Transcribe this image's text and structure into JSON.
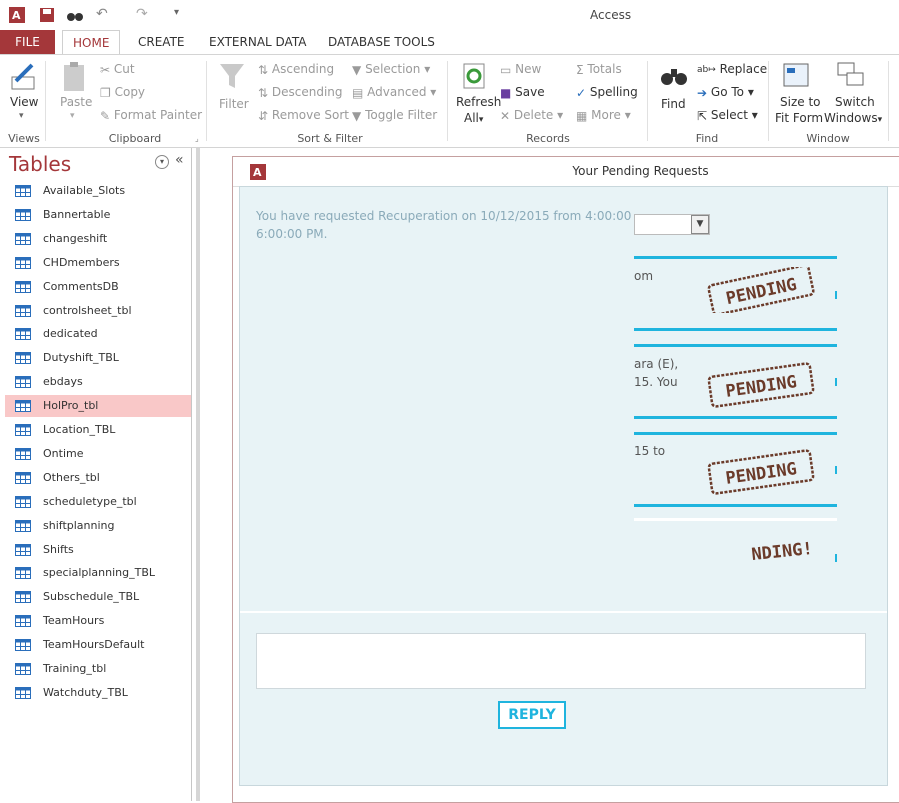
{
  "app": {
    "title": "Access"
  },
  "tabs": [
    "FILE",
    "HOME",
    "CREATE",
    "EXTERNAL DATA",
    "DATABASE TOOLS"
  ],
  "ribbon": {
    "views": {
      "label": "Views",
      "view": "View"
    },
    "clipboard": {
      "label": "Clipboard",
      "paste": "Paste",
      "cut": "Cut",
      "copy": "Copy",
      "format_painter": "Format Painter"
    },
    "sort_filter": {
      "label": "Sort & Filter",
      "filter": "Filter",
      "ascending": "Ascending",
      "descending": "Descending",
      "remove_sort": "Remove Sort",
      "selection": "Selection",
      "advanced": "Advanced",
      "toggle_filter": "Toggle Filter"
    },
    "records": {
      "label": "Records",
      "refresh": "Refresh",
      "refresh_all": "All",
      "new": "New",
      "save": "Save",
      "delete": "Delete",
      "totals": "Totals",
      "spelling": "Spelling",
      "more": "More"
    },
    "find": {
      "label": "Find",
      "find": "Find",
      "replace": "Replace",
      "goto": "Go To",
      "select": "Select"
    },
    "window": {
      "label": "Window",
      "size_fit_1": "Size to",
      "size_fit_2": "Fit Form",
      "switch_1": "Switch",
      "switch_2": "Windows"
    }
  },
  "nav": {
    "title": "Tables",
    "items": [
      "Available_Slots",
      "Bannertable",
      "changeshift",
      "CHDmembers",
      "CommentsDB",
      "controlsheet_tbl",
      "dedicated",
      "Dutyshift_TBL",
      "ebdays",
      "HolPro_tbl",
      "Location_TBL",
      "Ontime",
      "Others_tbl",
      "scheduletype_tbl",
      "shiftplanning",
      "Shifts",
      "specialplanning_TBL",
      "Subschedule_TBL",
      "TeamHours",
      "TeamHoursDefault",
      "Training_tbl",
      "Watchduty_TBL"
    ],
    "selected_index": 9
  },
  "form": {
    "title": "Your Pending Requests",
    "message_line1": "You have requested Recuperation on 10/12/2015 from 4:00:00",
    "message_line2": "6:00:00 PM.",
    "requests": [
      {
        "text1": "om",
        "text2": "",
        "stamp": "PENDING"
      },
      {
        "text1": "ara (E),",
        "text2": "15. You",
        "stamp": "PENDING"
      },
      {
        "text1": "15 to",
        "text2": "",
        "stamp": "PENDING"
      },
      {
        "text1": "",
        "text2": "",
        "stamp": "NDING!"
      }
    ],
    "reply_label": "REPLY",
    "reply_value": ""
  },
  "colors": {
    "accent": "#a4373a",
    "cyan": "#1fb4de",
    "stamp": "#6b3b2a",
    "form_bg": "#e8f3f6"
  }
}
